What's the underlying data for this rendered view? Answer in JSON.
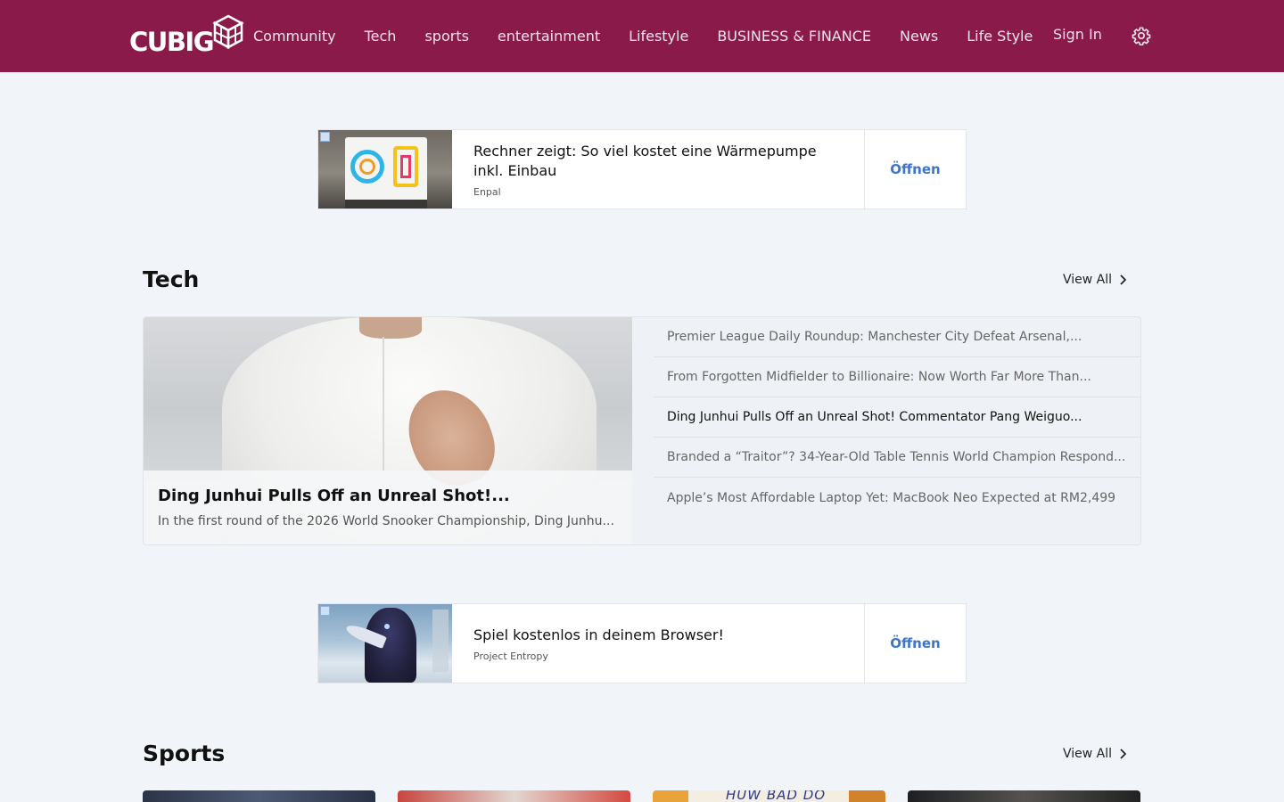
{
  "header": {
    "logo_text": "CUBIG",
    "nav": [
      "Community",
      "Tech",
      "sports",
      "entertainment",
      "Lifestyle",
      "BUSINESS & FINANCE",
      "News",
      "Life Style"
    ],
    "sign_in": "Sign In",
    "brand_color": "#8a1a49"
  },
  "ads": [
    {
      "title": "Rechner zeigt: So viel kostet eine Wärmepumpe inkl. Einbau",
      "source": "Enpal",
      "button": "Öffnen"
    },
    {
      "title": "Spiel kostenlos in deinem Browser!",
      "source": "Project Entropy",
      "button": "Öffnen"
    }
  ],
  "tech": {
    "title": "Tech",
    "view_all": "View All",
    "feature": {
      "title": "Ding Junhui Pulls Off an Unreal Shot!...",
      "description": "In the first round of the 2026 World Snooker Championship, Ding Junhu..."
    },
    "list": [
      "Premier League Daily Roundup: Manchester City Defeat Arsenal,...",
      "From Forgotten Midfielder to Billionaire: Now Worth Far More Than...",
      "Ding Junhui Pulls Off an Unreal Shot! Commentator Pang Weiguo...",
      "Branded a “Traitor”? 34-Year-Old Table Tennis World Champion Respond...",
      "Apple’s Most Affordable Laptop Yet: MacBook Neo Expected at RM2,499"
    ]
  },
  "sports": {
    "title": "Sports",
    "view_all": "View All",
    "card3_text": "HUW BAD DO"
  }
}
